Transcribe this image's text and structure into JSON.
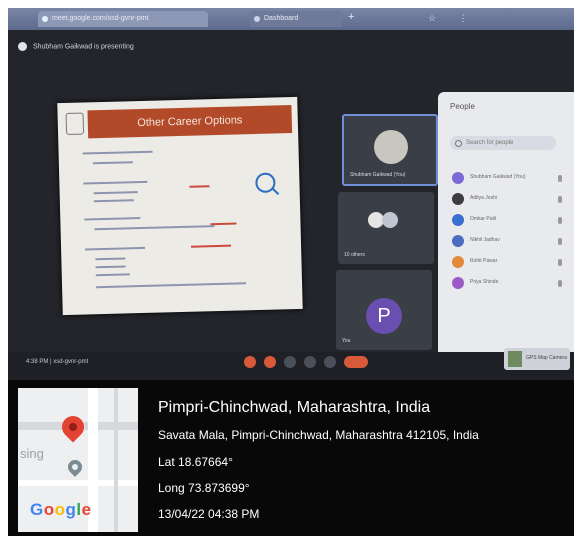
{
  "browser": {
    "tabs": [
      {
        "label": "meet.google.com/xsd-gvnr-pmt"
      },
      {
        "label": "Dashboard"
      }
    ]
  },
  "meet": {
    "presenter_notice": "Shubham Gaikwad is presenting",
    "slide": {
      "title": "Other Career Options"
    },
    "participants_title": "People",
    "search_placeholder": "Search for people",
    "tiles": [
      {
        "name": "Shubham Gaikwad (You)"
      },
      {
        "name": "10 others"
      },
      {
        "name": "You",
        "avatar_letter": "P"
      }
    ],
    "participants": [
      {
        "name": "Shubham Gaikwad (You)",
        "color": "#7c6ad6"
      },
      {
        "name": "Aditya Joshi",
        "color": "#3d3d3d"
      },
      {
        "name": "Omkar Patil",
        "color": "#3a6fd0"
      },
      {
        "name": "Nikhil Jadhav",
        "color": "#4d6cc0"
      },
      {
        "name": "Rohit Pawar",
        "color": "#e08a3a"
      },
      {
        "name": "Priya Shinde",
        "color": "#9a5ac8"
      }
    ],
    "meeting_info": "4:38 PM | xsd-gvnr-pmt",
    "profile_chip_label": "GPS Map Camera"
  },
  "geotag": {
    "city": "Pimpri-Chinchwad, Maharashtra, India",
    "address": "Savata Mala, Pimpri-Chinchwad, Maharashtra 412105, India",
    "lat": "Lat 18.67664°",
    "long": "Long 73.873699°",
    "datetime": "13/04/22 04:38 PM",
    "map_label": "sing",
    "google_logo": [
      "G",
      "o",
      "o",
      "g",
      "l",
      "e"
    ]
  }
}
